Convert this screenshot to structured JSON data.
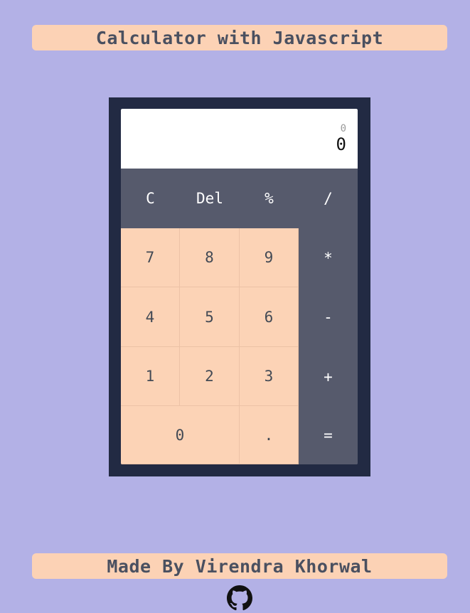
{
  "header": {
    "title": "Calculator with Javascript"
  },
  "display": {
    "previous": "0",
    "current": "0"
  },
  "keys": {
    "clear": "C",
    "delete": "Del",
    "percent": "%",
    "divide": "/",
    "seven": "7",
    "eight": "8",
    "nine": "9",
    "multiply": "*",
    "four": "4",
    "five": "5",
    "six": "6",
    "subtract": "-",
    "one": "1",
    "two": "2",
    "three": "3",
    "add": "+",
    "zero": "0",
    "decimal": ".",
    "equals": "="
  },
  "footer": {
    "credit": "Made By Virendra Khorwal",
    "icon": "github-icon"
  },
  "colors": {
    "background": "#b3b1e6",
    "banner": "#fcd2b5",
    "frame": "#222a43",
    "operator_keys": "#565a6c",
    "number_keys": "#fcd3b6"
  }
}
